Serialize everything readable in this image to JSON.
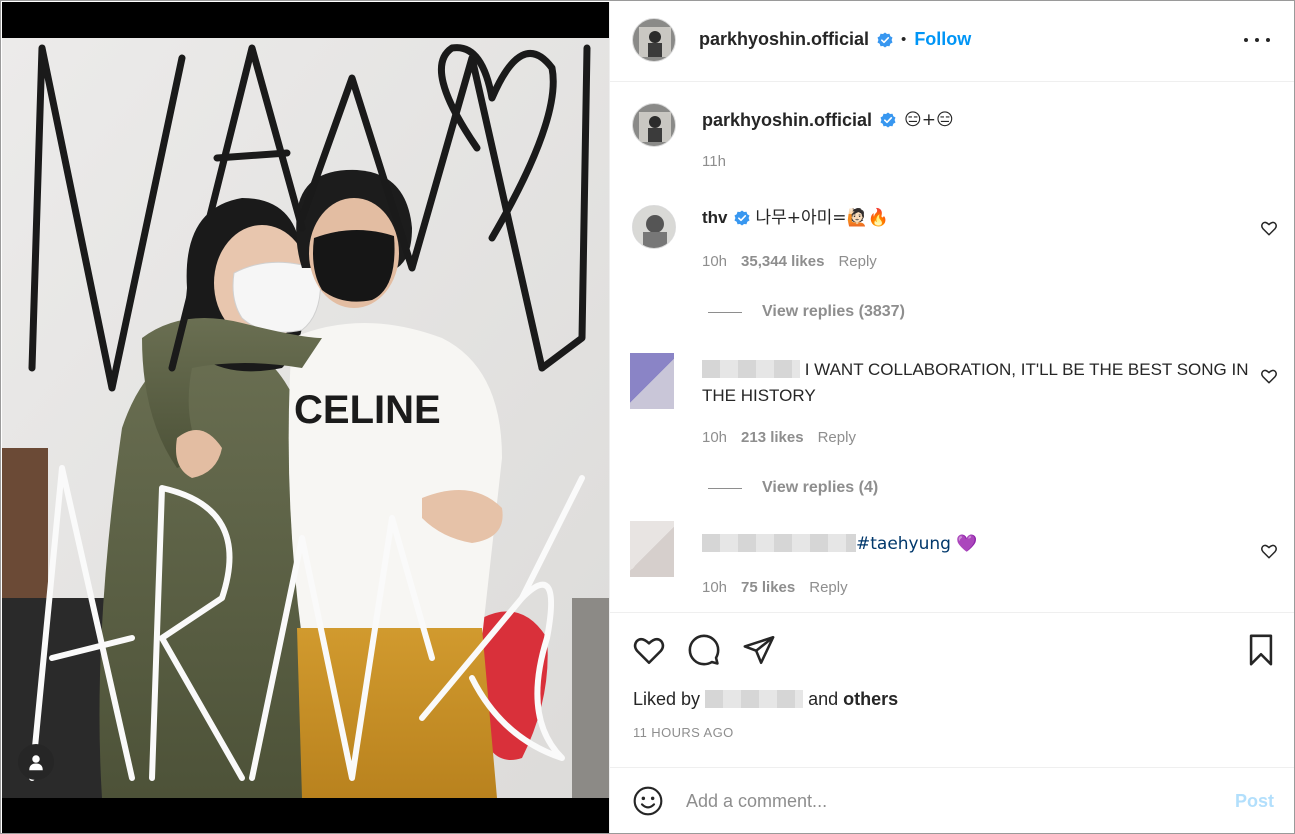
{
  "post": {
    "author": "parkhyoshin.official",
    "follow_label": "Follow",
    "dot": "•",
    "caption": "😑+😑",
    "caption_time": "11h"
  },
  "comments": [
    {
      "username": "thv",
      "verified": true,
      "text": "나무+아미=🙋🏻🔥",
      "time": "10h",
      "likes": "35,344 likes",
      "reply_label": "Reply",
      "view_replies": "View replies (3837)"
    },
    {
      "username": "",
      "text": "I WANT COLLABORATION, IT'LL BE THE BEST SONG IN THE HISTORY",
      "time": "10h",
      "likes": "213 likes",
      "reply_label": "Reply",
      "view_replies": "View replies (4)"
    },
    {
      "username": "",
      "text": "#taehyung",
      "heart_emoji": "💜",
      "time": "10h",
      "likes": "75 likes",
      "reply_label": "Reply"
    }
  ],
  "likes_line": {
    "prefix": "Liked by",
    "middle": "and",
    "suffix": "others"
  },
  "timestamp": "11 HOURS AGO",
  "composer": {
    "placeholder": "Add a comment...",
    "post_label": "Post"
  },
  "photo": {
    "shirt_text": "CELINE"
  },
  "colors": {
    "accent": "#0095f6",
    "verified": "#3897f0",
    "post_disabled": "#b2dffc",
    "hashtag": "#00376b"
  }
}
